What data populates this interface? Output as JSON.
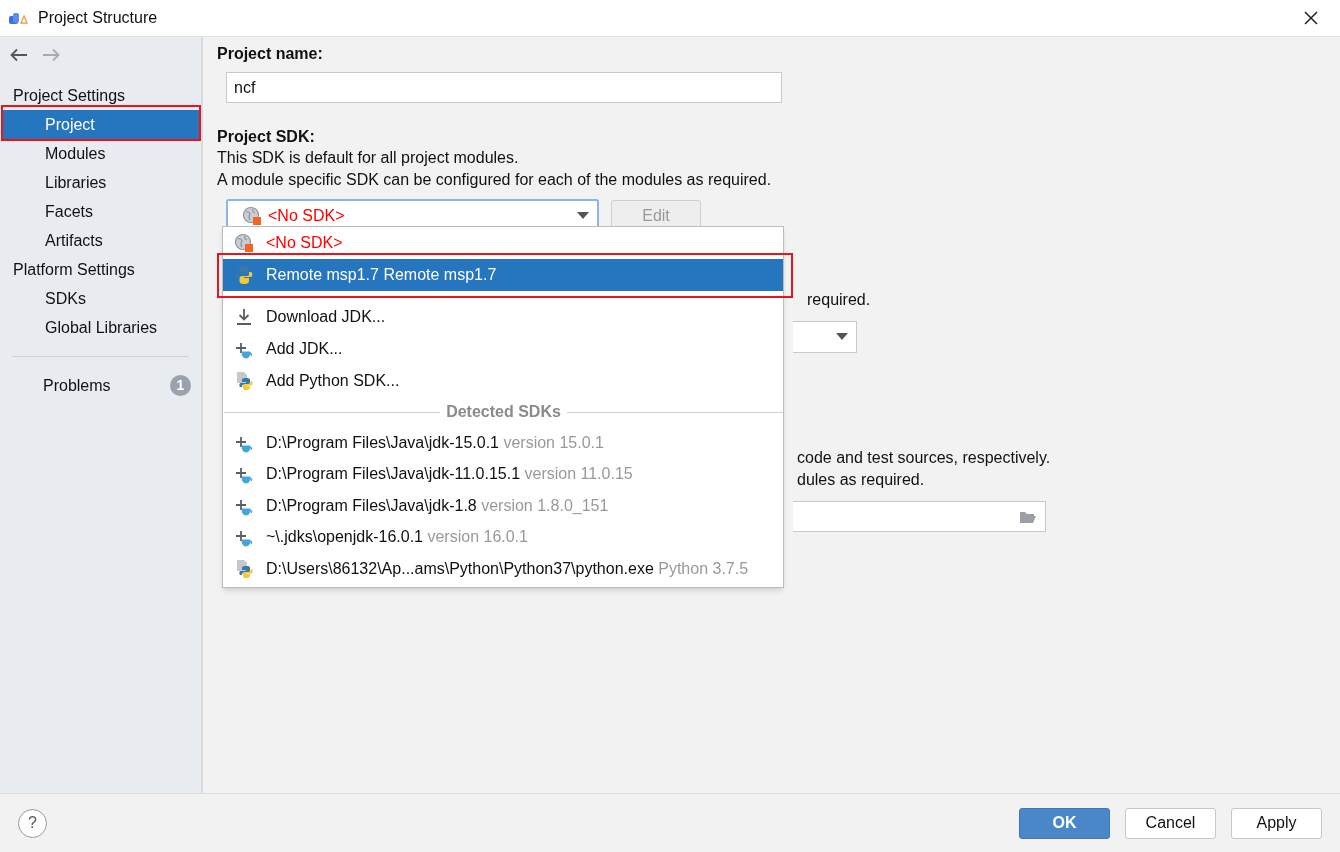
{
  "window": {
    "title": "Project Structure"
  },
  "nav": {
    "back_enabled": true,
    "forward_enabled": false
  },
  "sidebar": {
    "sections": [
      {
        "title": "Project Settings",
        "items": [
          {
            "label": "Project",
            "selected": true
          },
          {
            "label": "Modules",
            "selected": false
          },
          {
            "label": "Libraries",
            "selected": false
          },
          {
            "label": "Facets",
            "selected": false
          },
          {
            "label": "Artifacts",
            "selected": false
          }
        ]
      },
      {
        "title": "Platform Settings",
        "items": [
          {
            "label": "SDKs",
            "selected": false
          },
          {
            "label": "Global Libraries",
            "selected": false
          }
        ]
      }
    ],
    "problems": {
      "label": "Problems",
      "count": "1",
      "selected": false
    }
  },
  "project_name": {
    "label": "Project name:",
    "value": "ncf"
  },
  "project_sdk": {
    "label": "Project SDK:",
    "lines": [
      "This SDK is default for all project modules.",
      "A module specific SDK can be configured for each of the modules as required."
    ],
    "value": "<No SDK>",
    "edit_button": {
      "label": "Edit",
      "disabled": true
    }
  },
  "background_fragments": {
    "line_1": "required.",
    "line_2": "code and test sources, respectively.",
    "line_3": "dules as required."
  },
  "sdk_popup": {
    "items": [
      {
        "kind": "no-sdk",
        "label": "<No SDK>",
        "selected": false
      },
      {
        "kind": "python",
        "label": "Remote msp1.7 Remote msp1.7",
        "selected": true
      },
      {
        "kind": "download",
        "label": "Download JDK...",
        "selected": false
      },
      {
        "kind": "jdk",
        "label": "Add JDK...",
        "selected": false
      },
      {
        "kind": "python-file",
        "label": "Add Python SDK...",
        "selected": false
      }
    ],
    "group_title": "Detected SDKs",
    "detected": [
      {
        "kind": "jdk",
        "path": "D:\\Program Files\\Java\\jdk-15.0.1",
        "version": "version 15.0.1",
        "selected": false
      },
      {
        "kind": "jdk",
        "path": "D:\\Program Files\\Java\\jdk-11.0.15.1",
        "version": "version 11.0.15",
        "selected": false
      },
      {
        "kind": "jdk",
        "path": "D:\\Program Files\\Java\\jdk-1.8",
        "version": "version 1.8.0_151",
        "selected": false
      },
      {
        "kind": "jdk",
        "path": "~\\.jdks\\openjdk-16.0.1",
        "version": "version 16.0.1",
        "selected": false
      },
      {
        "kind": "python-file",
        "path": "D:\\Users\\86132\\Ap...ams\\Python\\Python37\\python.exe",
        "version": "Python 3.7.5",
        "selected": false
      }
    ]
  },
  "footer": {
    "help": "?",
    "buttons": [
      {
        "label": "OK",
        "kind": "primary"
      },
      {
        "label": "Cancel",
        "kind": "default"
      },
      {
        "label": "Apply",
        "kind": "default"
      }
    ]
  }
}
